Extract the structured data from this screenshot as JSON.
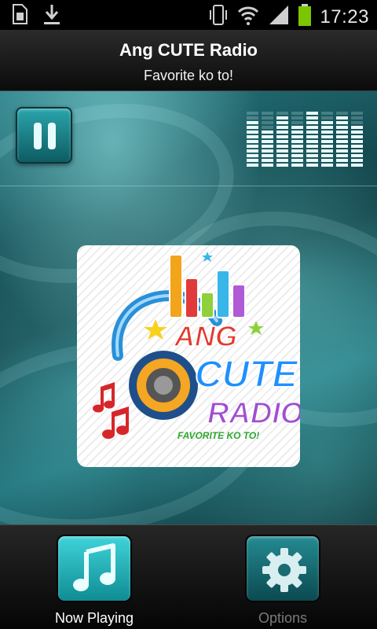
{
  "status_bar": {
    "time": "17:23",
    "icons": [
      "sim-card-icon",
      "download-icon",
      "vibrate-icon",
      "wifi-icon",
      "signal-icon",
      "battery-icon"
    ],
    "battery_color": "#7bc600"
  },
  "header": {
    "title": "Ang CUTE Radio",
    "subtitle": "Favorite ko to!"
  },
  "player": {
    "state": "playing",
    "control_icon": "pause-icon",
    "visualizer_icon": "equalizer-icon",
    "accent_color": "#1fa9b1"
  },
  "artwork": {
    "logo_lines": [
      "ANG",
      "CUTE",
      "RADIO",
      "FAVORITE KO TO!"
    ]
  },
  "bottom_nav": {
    "items": [
      {
        "label": "Now Playing",
        "icon": "music-note-icon",
        "active": true
      },
      {
        "label": "Options",
        "icon": "gear-icon",
        "active": false
      }
    ]
  }
}
